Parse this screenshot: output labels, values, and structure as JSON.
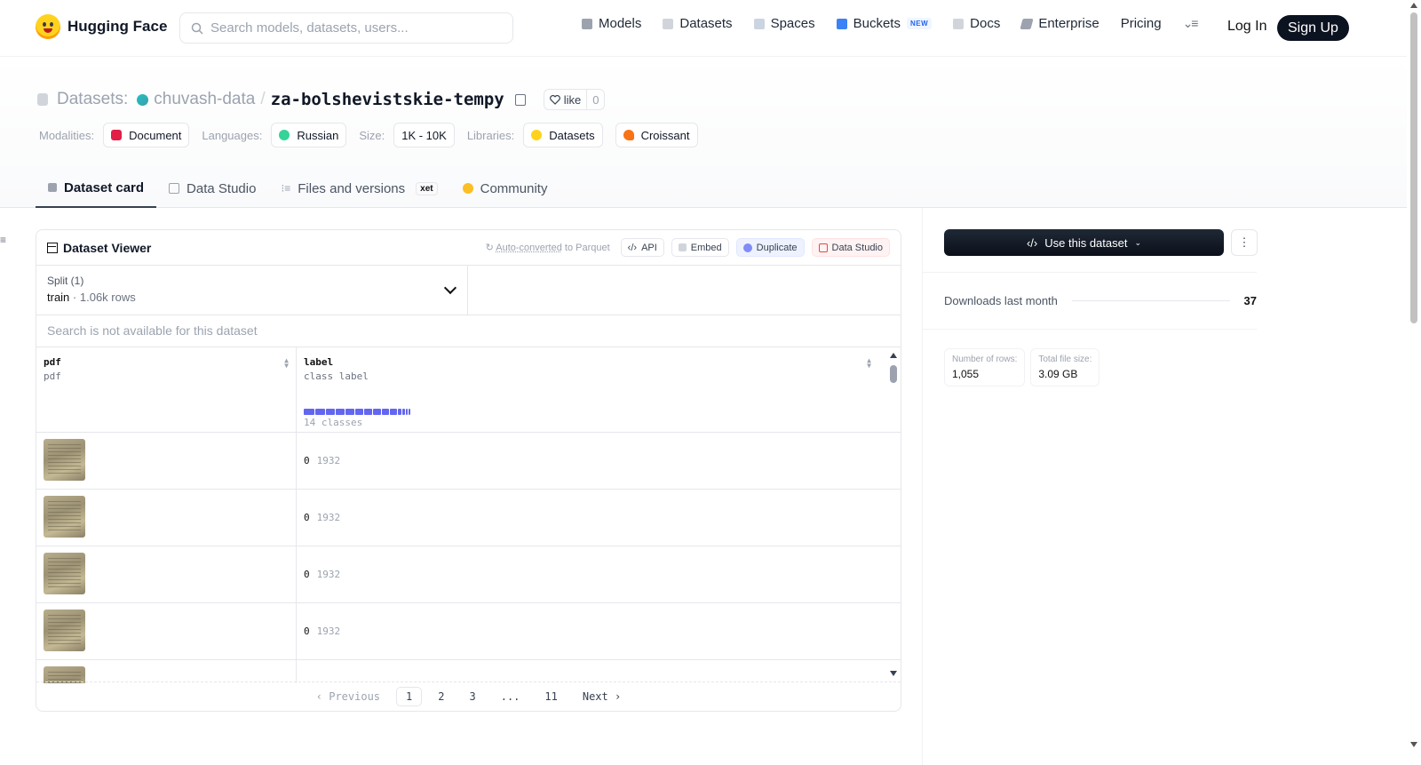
{
  "nav": {
    "brand": "Hugging Face",
    "search_placeholder": "Search models, datasets, users...",
    "links": [
      "Models",
      "Datasets",
      "Spaces",
      "Buckets",
      "Docs",
      "Enterprise",
      "Pricing"
    ],
    "buckets_badge": "NEW",
    "login": "Log In",
    "signup": "Sign Up"
  },
  "repo": {
    "prefix": "Datasets:",
    "org": "chuvash-data",
    "separator": "/",
    "name": "za-bolshevistskie-tempy",
    "like_label": "like",
    "like_count": "0"
  },
  "meta": {
    "modalities_label": "Modalities:",
    "modality": "Document",
    "languages_label": "Languages:",
    "language": "Russian",
    "size_label": "Size:",
    "size": "1K - 10K",
    "libraries_label": "Libraries:",
    "libraries": [
      "Datasets",
      "Croissant"
    ]
  },
  "tabs": [
    "Dataset card",
    "Data Studio",
    "Files and versions",
    "Community"
  ],
  "xet_badge": "xet",
  "viewer": {
    "title": "Dataset Viewer",
    "auto_converted_link": "Auto-converted",
    "auto_converted_rest": " to Parquet",
    "actions": [
      "API",
      "Embed",
      "Duplicate",
      "Data Studio"
    ],
    "split_label": "Split (1)",
    "split_name": "train",
    "split_rows": "1.06k rows",
    "search_na": "Search is not available for this dataset",
    "columns": [
      {
        "name": "pdf",
        "type": "pdf"
      },
      {
        "name": "label",
        "type": "class label",
        "summary": "14 classes"
      }
    ],
    "rows": [
      {
        "code": "0",
        "label": "1932"
      },
      {
        "code": "0",
        "label": "1932"
      },
      {
        "code": "0",
        "label": "1932"
      },
      {
        "code": "0",
        "label": "1932"
      }
    ],
    "pagination": {
      "previous": "Previous",
      "pages": [
        "1",
        "2",
        "3",
        "...",
        "11"
      ],
      "next": "Next",
      "current": "1"
    }
  },
  "sidebar": {
    "use_button": "Use this dataset",
    "downloads_label": "Downloads last month",
    "downloads_value": "37",
    "rows_label": "Number of rows:",
    "rows_value": "1,055",
    "size_label": "Total file size:",
    "size_value": "3.09 GB"
  },
  "colors": {
    "accent": "#6366f1",
    "signup_bg": "#0b1220",
    "modality_icon": "#e11d48",
    "duplicate_bg": "#eef2ff",
    "data_studio_bg": "#fef2f2"
  }
}
